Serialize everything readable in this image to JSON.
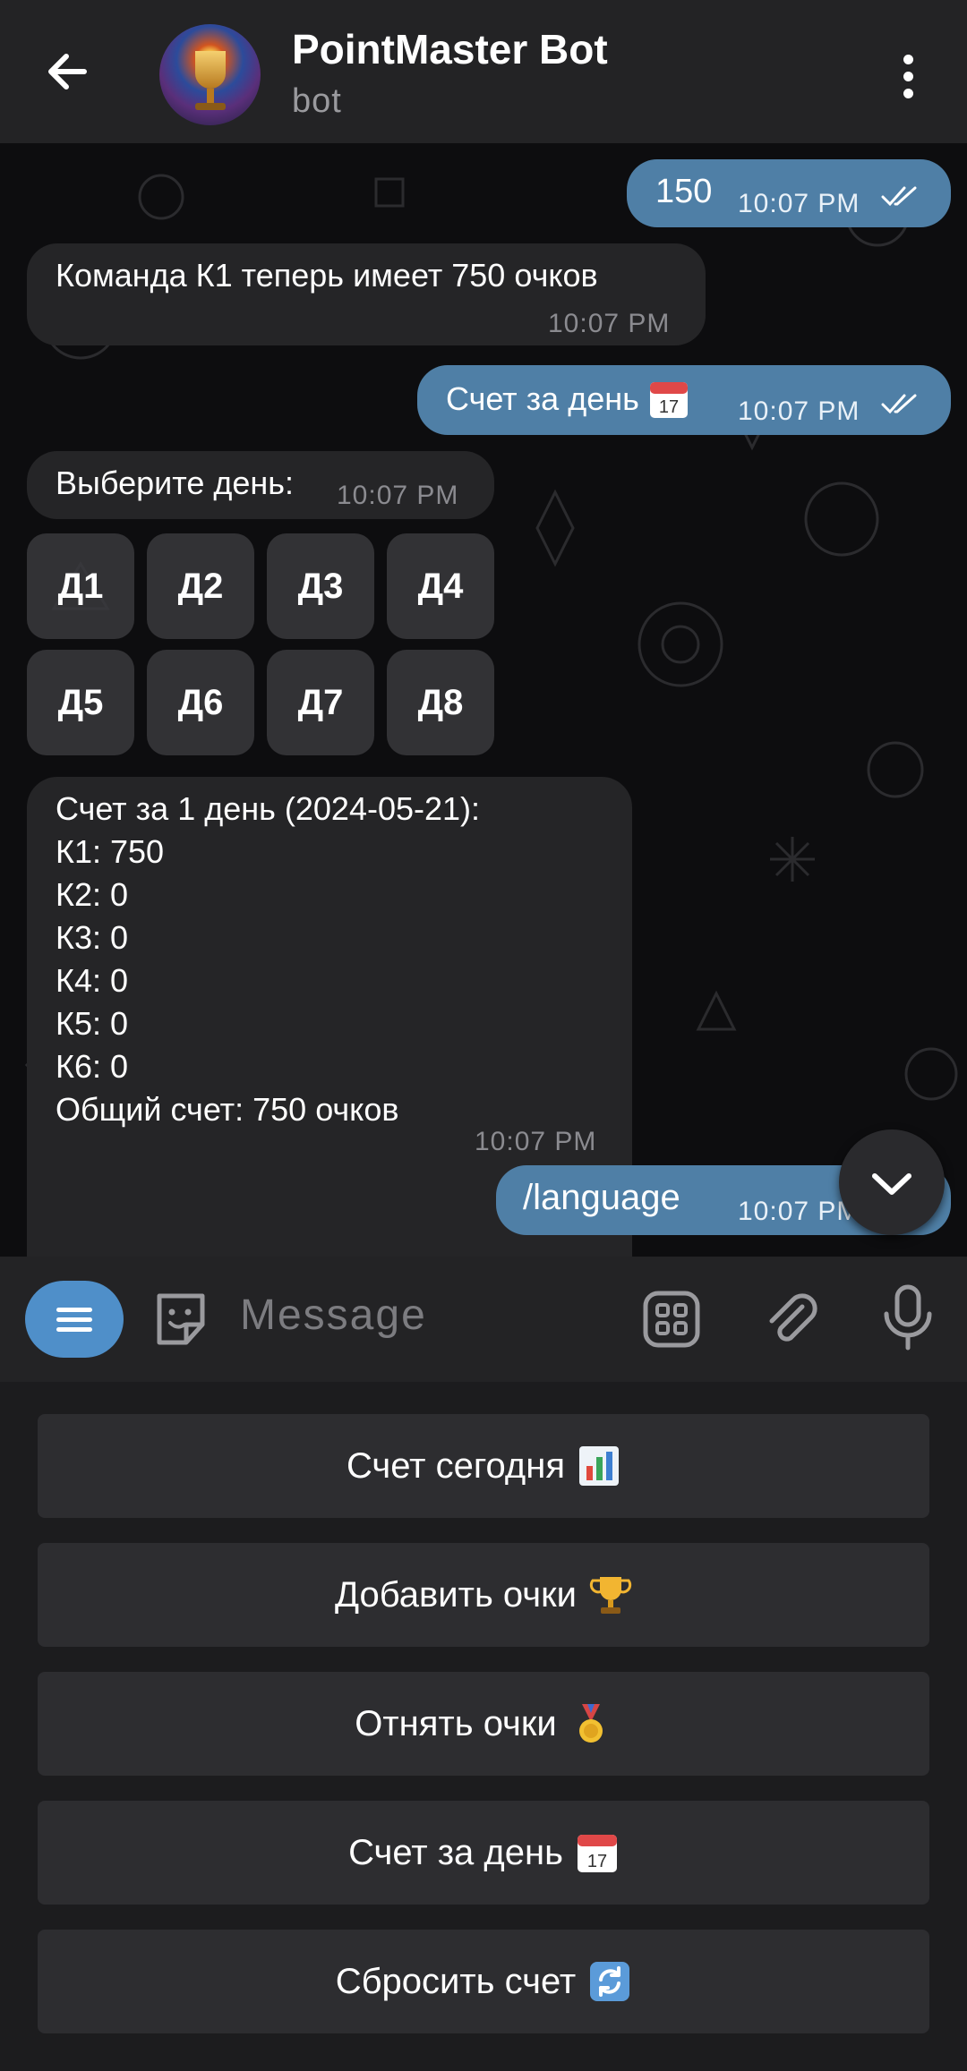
{
  "header": {
    "title": "PointMaster Bot",
    "subtitle": "bot"
  },
  "messages": {
    "m1": {
      "text": "150",
      "time": "10:07 PM"
    },
    "m2": {
      "text": "Команда К1 теперь имеет 750 очков",
      "time": "10:07 PM"
    },
    "m3": {
      "text": "Счет за день",
      "time": "10:07 PM"
    },
    "m4": {
      "text": "Выберите день:",
      "time": "10:07 PM"
    },
    "day_buttons": [
      "Д1",
      "Д2",
      "Д3",
      "Д4",
      "Д5",
      "Д6",
      "Д7",
      "Д8"
    ],
    "m5": {
      "lines": [
        "Счет за 1 день (2024-05-21):",
        "К1: 750",
        "К2: 0",
        "К3: 0",
        "К4: 0",
        "К5: 0",
        "К6: 0",
        "Общий счет: 750 очков"
      ],
      "time": "10:07 PM"
    },
    "m6": {
      "text": "/language",
      "time": "10:07 PM"
    }
  },
  "input": {
    "placeholder": "Message"
  },
  "reply_keyboard": [
    {
      "label": "Счет сегодня",
      "icon": "bar-chart-emoji"
    },
    {
      "label": "Добавить очки",
      "icon": "trophy-emoji"
    },
    {
      "label": "Отнять очки",
      "icon": "medal-emoji"
    },
    {
      "label": "Счет за день",
      "icon": "calendar-emoji"
    },
    {
      "label": "Сбросить счет",
      "icon": "refresh-emoji"
    }
  ],
  "colors": {
    "outgoing_bubble": "#4f7fa6",
    "incoming_bubble": "#252527",
    "accent": "#4f8fc9"
  }
}
